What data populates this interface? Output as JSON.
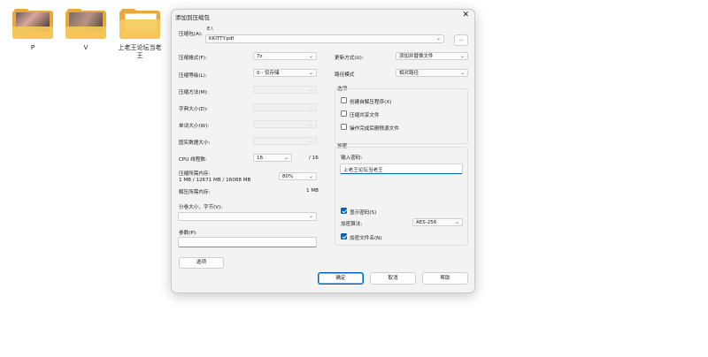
{
  "desktop": {
    "icons": [
      {
        "label": "P"
      },
      {
        "label": "V"
      },
      {
        "label": "上老王论坛当老王"
      }
    ]
  },
  "dialog": {
    "title": "添加到压缩包",
    "archive": {
      "label": "压缩包(A):",
      "path_prefix": "E:\\",
      "value": "KKITTY.pdf",
      "browse_label": "..."
    },
    "left": {
      "format": {
        "label": "压缩格式(F):",
        "value": "7z"
      },
      "level": {
        "label": "压缩等级(L):",
        "value": "0 - 仅存储"
      },
      "method": {
        "label": "压缩方法(M):",
        "value": ""
      },
      "dict_size": {
        "label": "字典大小(D):",
        "value": ""
      },
      "word_size": {
        "label": "单词大小(W):",
        "value": ""
      },
      "solid_size": {
        "label": "固实数据大小:",
        "value": ""
      },
      "cpu": {
        "label": "CPU 线程数:",
        "value": "16",
        "total": "/ 16"
      },
      "mem_compress": {
        "label": "压缩所需内存:",
        "detail": "1 MB / 12671 MB / 16088 MB",
        "value": "80%"
      },
      "mem_decompress": {
        "label": "解压所需内存:",
        "value": "1 MB"
      },
      "split": {
        "label": "分卷大小，字节(V):",
        "value": ""
      },
      "params": {
        "label": "参数(P):",
        "value": ""
      },
      "options_button": "选项"
    },
    "right": {
      "update_mode": {
        "label": "更新方式(U):",
        "value": "添加并替换文件"
      },
      "path_mode": {
        "label": "路径模式",
        "value": "相对路径"
      },
      "options_group": {
        "title": "选项",
        "sfx": {
          "label": "创建自解压程序(X)",
          "checked": false
        },
        "shared": {
          "label": "压缩共享文件",
          "checked": false
        },
        "delete_after": {
          "label": "操作完成后删除源文件",
          "checked": false
        }
      },
      "encryption_group": {
        "title": "加密",
        "password_label": "输入密码:",
        "password_value": "上老王论坛当老王",
        "show_password": {
          "label": "显示密码(S)",
          "checked": true
        },
        "method_label": "加密算法:",
        "method_value": "AES-256",
        "encrypt_names": {
          "label": "加密文件名(N)",
          "checked": true
        }
      }
    },
    "buttons": {
      "ok": "确定",
      "cancel": "取消",
      "help": "帮助"
    }
  }
}
